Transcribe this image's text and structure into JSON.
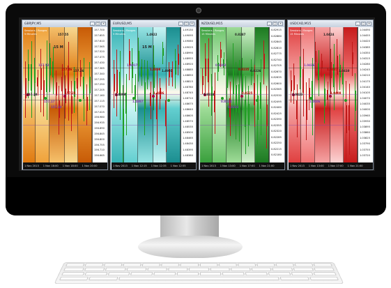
{
  "windows": [
    {
      "title": "GBPJPY,M5",
      "info": [
        "Sessions / Ranges",
        "5 Minutes"
      ],
      "theme": "orange",
      "center_label": "15 M",
      "time_labels": [
        "1 Nov 2013",
        "1 Nov 16:00",
        "1 Nov 18:00",
        "1 Nov 20:00"
      ],
      "price_ticks": [
        "157.700",
        "157.655",
        "157.610",
        "157.565",
        "157.520",
        "157.475",
        "157.430",
        "157.385",
        "157.340",
        "157.295",
        "157.250",
        "157.205",
        "157.160",
        "157.115",
        "157.070",
        "157.025",
        "156.980",
        "156.935",
        "156.890",
        "156.845",
        "156.800",
        "156.755",
        "156.710",
        "156.665"
      ],
      "labels": [
        "157.55",
        "157.52",
        "157.46",
        "157.18",
        "157.17",
        "157.25",
        "157.26",
        "157.24"
      ]
    },
    {
      "title": "EURUSD,M5",
      "info": [
        "Sessions / Ranges",
        "5 Minutes"
      ],
      "theme": "teal",
      "center_label": "15 M",
      "time_labels": [
        "1 Nov 2013",
        "1 Nov 12:15",
        "1 Nov 12:35",
        "1 Nov 12:55"
      ],
      "price_ticks": [
        "1.49130",
        "1.49095",
        "1.49060",
        "1.49025",
        "1.48990",
        "1.48955",
        "1.48920",
        "1.48885",
        "1.48850",
        "1.48815",
        "1.48780",
        "1.48745",
        "1.48710",
        "1.48675",
        "1.48640",
        "1.48605",
        "1.48570",
        "1.48535",
        "1.48500",
        "1.48465",
        "1.48430",
        "1.48395",
        "1.48360"
      ],
      "labels": [
        "1.4922",
        "1.4917",
        "1.4898",
        "1.4899",
        "1.4897",
        "1.4896",
        "1.4901"
      ]
    },
    {
      "title": "NZDUSD,M15",
      "info": [
        "Sessions / Ranges",
        "15 Minutes"
      ],
      "theme": "green",
      "center_label": "",
      "time_labels": [
        "1 Nov 2013",
        "1 Nov 13:00",
        "1 Nov 17:00",
        "1 Nov 21:00"
      ],
      "price_ticks": [
        "0.82915",
        "0.82880",
        "0.82845",
        "0.82810",
        "0.82775",
        "0.82740",
        "0.82705",
        "0.82670",
        "0.82635",
        "0.82600",
        "0.82565",
        "0.82530",
        "0.82495",
        "0.82460",
        "0.82425",
        "0.82390",
        "0.82355",
        "0.82320",
        "0.82285",
        "0.82250",
        "0.82215",
        "0.82180"
      ],
      "labels": [
        "0.8287",
        "0.8282",
        "0.8235",
        "0.8234",
        "0.8224",
        "0.8225",
        "0.8226",
        "0.8223"
      ]
    },
    {
      "title": "USDCAD,M15",
      "info": [
        "Sessions / Ranges",
        "15 Minutes"
      ],
      "theme": "red",
      "center_label": "",
      "time_labels": [
        "1 Nov 2013",
        "1 Nov 13:00",
        "1 Nov 17:00",
        "1 Nov 21:00"
      ],
      "price_ticks": [
        "1.04490",
        "1.04455",
        "1.04420",
        "1.04385",
        "1.04350",
        "1.04315",
        "1.04280",
        "1.04245",
        "1.04210",
        "1.04175",
        "1.04140",
        "1.04105",
        "1.04070",
        "1.04035",
        "1.04000",
        "1.03965",
        "1.03930",
        "1.03895",
        "1.03860",
        "1.03825",
        "1.03790",
        "1.03755",
        "1.03720"
      ],
      "labels": [
        "1.0424",
        "1.0426",
        "1.0427",
        "1.0423",
        "1.0406",
        "1.0408",
        "1.0410"
      ]
    }
  ],
  "window_buttons": [
    "_",
    "□",
    "×"
  ],
  "colors": {
    "orange": [
      "#c75a06",
      "#e07a10",
      "#f0a23b",
      "#f5c06a",
      "#f7d890"
    ],
    "teal": [
      "#1b8e90",
      "#36b2b4",
      "#63cfd0",
      "#96e3e3",
      "#c8f3f3"
    ],
    "green": [
      "#1c7a21",
      "#3aa03d",
      "#6cc46a",
      "#9fdc98",
      "#d2f0cc"
    ],
    "red": [
      "#c71b1b",
      "#e04040",
      "#ee7070",
      "#f5a3a3",
      "#fbd2d2"
    ],
    "bull": "#1f9e22",
    "bear": "#c01818"
  }
}
